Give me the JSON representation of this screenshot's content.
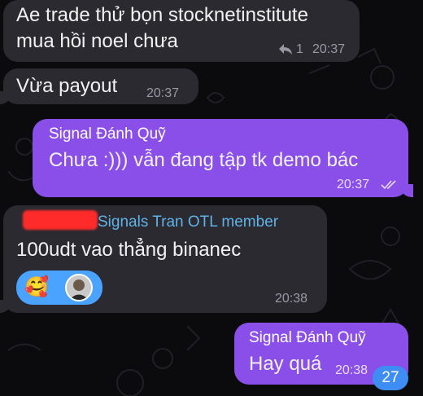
{
  "chat": {
    "messages": [
      {
        "direction": "incoming",
        "text_line1": "Ae trade thử bọn stocknetinstitute",
        "text_line2": "mua hồi noel chưa",
        "reply_count": "1",
        "time": "20:37"
      },
      {
        "direction": "incoming",
        "text": "Vừa payout",
        "time": "20:37"
      },
      {
        "direction": "outgoing",
        "sender": "Signal Đánh Quỹ",
        "text": "Chưa :))) vẫn đang tập tk demo bác",
        "time": "20:37",
        "status": "read"
      },
      {
        "direction": "incoming",
        "sender_suffix": "Signals Tran OTL member",
        "text": "100udt vao thẳng binanec",
        "reaction_emoji": "🥰",
        "time": "20:38"
      },
      {
        "direction": "outgoing",
        "sender": "Signal Đánh Quỹ",
        "text": "Hay quá",
        "time": "20:38"
      }
    ],
    "unread_count": "27",
    "icons": {
      "reply": "reply-arrow-icon",
      "read_status": "double-check-icon",
      "reaction": "smiling-face-with-hearts-icon",
      "avatar": "user-avatar"
    },
    "colors": {
      "background": "#0b0b0e",
      "incoming_bubble": "#2b2a31",
      "outgoing_bubble": "#8a4fe8",
      "sender_incoming": "#5fb3e8",
      "reaction_pill": "#4aa3ff",
      "unread_badge": "#3d8df5",
      "redaction": "#ff2a2a"
    }
  }
}
